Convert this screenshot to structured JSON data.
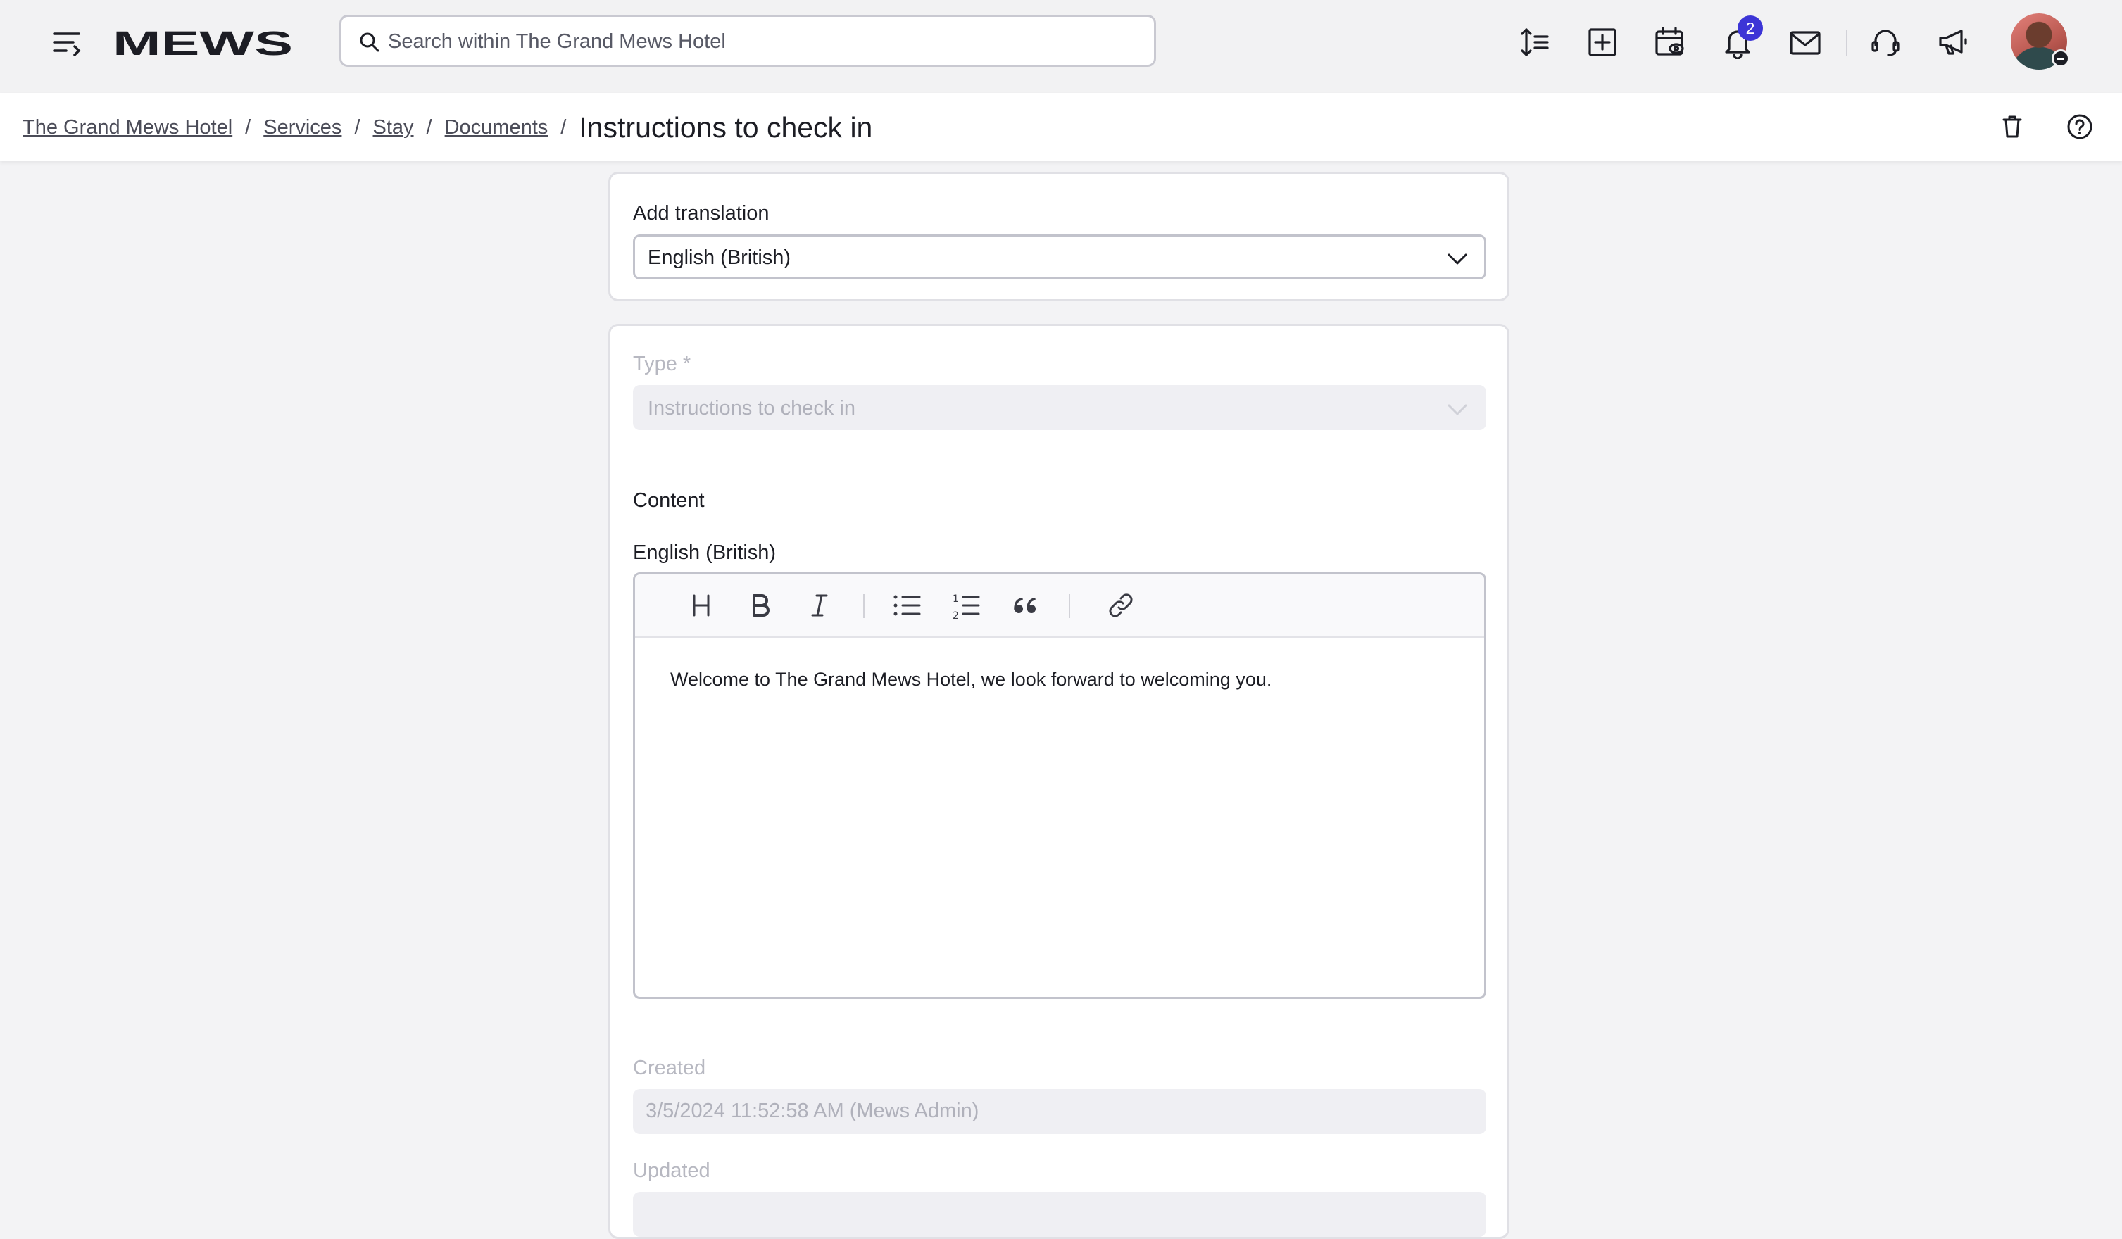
{
  "topbar": {
    "logo_text": "MEWS",
    "search": {
      "placeholder": "Search within The Grand Mews Hotel",
      "value": ""
    },
    "icons": [
      "menu-icon",
      "line-spacing-icon",
      "add-box-icon",
      "calendar-view-icon",
      "bell-icon",
      "mail-icon",
      "headset-icon",
      "megaphone-icon"
    ],
    "notifications_count": "2"
  },
  "breadcrumb": {
    "items": [
      "The Grand Mews Hotel",
      "Services",
      "Stay",
      "Documents"
    ],
    "separator": "/",
    "current": "Instructions to check in"
  },
  "translation": {
    "label": "Add translation",
    "selected": "English (British)"
  },
  "form": {
    "type_label": "Type *",
    "type_value": "Instructions to check in",
    "content_label": "Content",
    "language_label": "English (British)",
    "editor_tools": [
      "heading",
      "bold",
      "italic",
      "bullet-list",
      "numbered-list",
      "quote",
      "link"
    ],
    "content_text": "Welcome to The Grand Mews Hotel, we look forward to welcoming you.",
    "created_label": "Created",
    "created_value": "3/5/2024 11:52:58 AM (Mews Admin)",
    "updated_label": "Updated"
  },
  "colors": {
    "accent": "#3c35d6",
    "text": "#1c1d24",
    "muted": "#b0b1bb",
    "topbar_bg": "#f2f2f3"
  }
}
